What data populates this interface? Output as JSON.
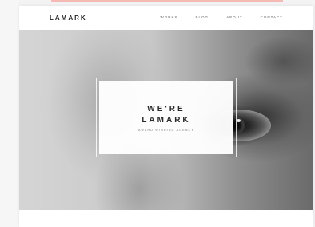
{
  "site": {
    "logo": "LAMARK",
    "nav": [
      "WORKS",
      "BLOG",
      "ABOUT",
      "CONTACT"
    ]
  },
  "hero": {
    "line1": "WE'RE",
    "line2": "LAMARK",
    "tagline": "AWARD WINNING AGENCY"
  },
  "colors": {
    "accent_strip": "#f4b9b2",
    "background": "#f3f3f4",
    "text_dark": "#222222"
  }
}
